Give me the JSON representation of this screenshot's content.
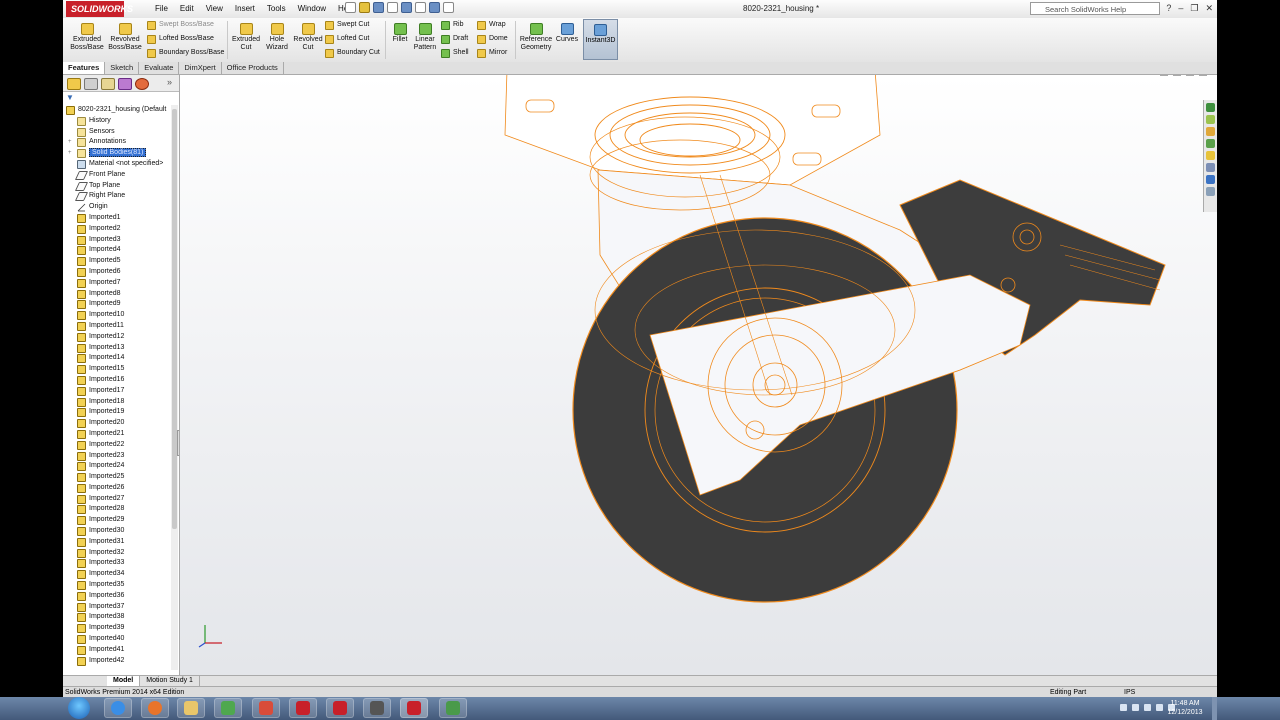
{
  "app": {
    "brand": "SOLIDWORKS",
    "menus": [
      "File",
      "Edit",
      "View",
      "Insert",
      "Tools",
      "Window",
      "Help"
    ],
    "document_title": "8020-2321_housing *",
    "search_placeholder": "Search SolidWorks Help"
  },
  "command_manager": {
    "extruded_boss": "Extruded Boss/Base",
    "revolved_boss": "Revolved Boss/Base",
    "swept_boss": "Swept Boss/Base",
    "lofted_boss": "Lofted Boss/Base",
    "boundary_boss": "Boundary Boss/Base",
    "extruded_cut": "Extruded Cut",
    "hole_wizard": "Hole Wizard",
    "revolved_cut": "Revolved Cut",
    "swept_cut": "Swept Cut",
    "lofted_cut": "Lofted Cut",
    "boundary_cut": "Boundary Cut",
    "fillet": "Fillet",
    "linear_pattern": "Linear Pattern",
    "rib": "Rib",
    "draft": "Draft",
    "shell": "Shell",
    "wrap": "Wrap",
    "dome": "Dome",
    "mirror": "Mirror",
    "reference_geometry": "Reference Geometry",
    "curves": "Curves",
    "instant3d": "Instant3D",
    "tabs": [
      "Features",
      "Sketch",
      "Evaluate",
      "DimXpert",
      "Office Products"
    ]
  },
  "feature_tree": {
    "root": "8020-2321_housing  (Default",
    "items": [
      "History",
      "Sensors",
      "Annotations"
    ],
    "selected": "Solid Bodies(81)",
    "material": "Material <not specified>",
    "planes": [
      "Front Plane",
      "Top Plane",
      "Right Plane"
    ],
    "origin": "Origin",
    "imported": [
      "Imported1",
      "Imported2",
      "Imported3",
      "Imported4",
      "Imported5",
      "Imported6",
      "Imported7",
      "Imported8",
      "Imported9",
      "Imported10",
      "Imported11",
      "Imported12",
      "Imported13",
      "Imported14",
      "Imported15",
      "Imported16",
      "Imported17",
      "Imported18",
      "Imported19",
      "Imported20",
      "Imported21",
      "Imported22",
      "Imported23",
      "Imported24",
      "Imported25",
      "Imported26",
      "Imported27",
      "Imported28",
      "Imported29",
      "Imported30",
      "Imported31",
      "Imported32",
      "Imported33",
      "Imported34",
      "Imported35",
      "Imported36",
      "Imported37",
      "Imported38",
      "Imported39",
      "Imported40",
      "Imported41",
      "Imported42"
    ]
  },
  "bottom_tabs": [
    "Model",
    "Motion Study 1"
  ],
  "status": {
    "edition": "SolidWorks Premium 2014 x64 Edition",
    "mode": "Editing Part",
    "units": "IPS"
  },
  "taskbar": {
    "time": "11:48 AM",
    "date": "12/12/2013"
  },
  "colors": {
    "selection": "#3370d2",
    "edge_highlight": "#f08a1c",
    "wheel": "#3d3d3d",
    "accent_red": "#c8202a"
  }
}
